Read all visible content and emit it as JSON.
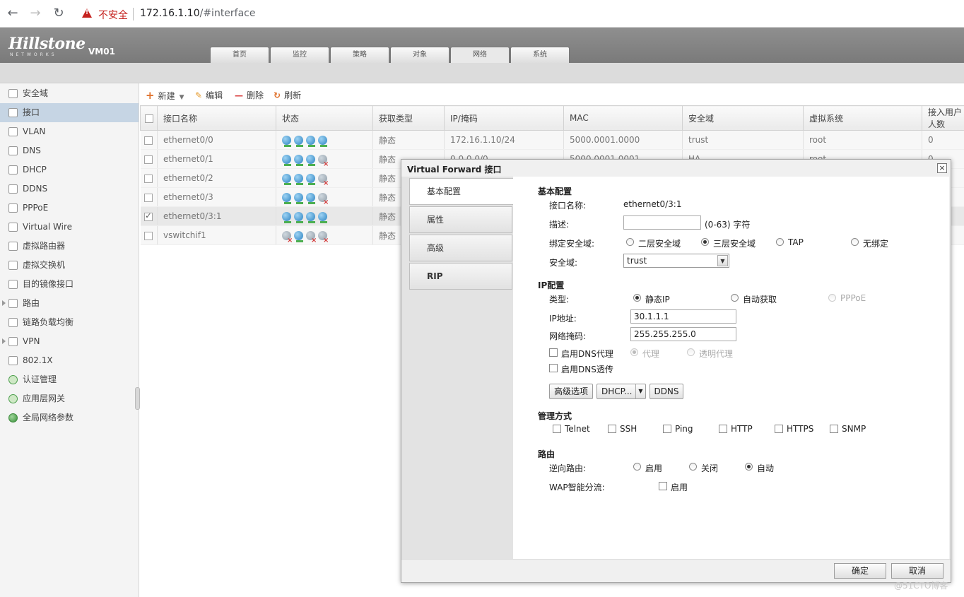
{
  "browser": {
    "back": "←",
    "forward": "→",
    "reload": "↻",
    "security_text": "不安全",
    "url_host": "172.16.1.10",
    "url_path": "/#interface"
  },
  "header": {
    "logo": "Hillstone",
    "logo_sub": "NETWORKS",
    "device": "VM01",
    "tabs": [
      "首页",
      "监控",
      "策略",
      "对象",
      "网络",
      "系统"
    ],
    "active_tab": "网络"
  },
  "sidebar": {
    "items": [
      {
        "label": "安全域"
      },
      {
        "label": "接口",
        "active": true
      },
      {
        "label": "VLAN"
      },
      {
        "label": "DNS"
      },
      {
        "label": "DHCP"
      },
      {
        "label": "DDNS"
      },
      {
        "label": "PPPoE"
      },
      {
        "label": "Virtual Wire"
      },
      {
        "label": "虚拟路由器"
      },
      {
        "label": "虚拟交换机"
      },
      {
        "label": "目的镜像接口"
      },
      {
        "label": "路由",
        "expandable": true
      },
      {
        "label": "链路负载均衡"
      },
      {
        "label": "VPN",
        "expandable": true
      },
      {
        "label": "802.1X"
      },
      {
        "label": "认证管理"
      },
      {
        "label": "应用层网关"
      },
      {
        "label": "全局网络参数"
      }
    ]
  },
  "toolbar": {
    "new": "新建",
    "edit": "编辑",
    "delete": "删除",
    "refresh": "刷新"
  },
  "table": {
    "columns": [
      "接口名称",
      "状态",
      "获取类型",
      "IP/掩码",
      "MAC",
      "安全域",
      "虚拟系统",
      "接入用户人数"
    ],
    "rows": [
      {
        "name": "ethernet0/0",
        "status": [
          "up",
          "up",
          "up",
          "up"
        ],
        "type": "静态",
        "ip": "172.16.1.10/24",
        "mac": "5000.0001.0000",
        "zone": "trust",
        "vsys": "root",
        "users": "0",
        "checked": false
      },
      {
        "name": "ethernet0/1",
        "status": [
          "up",
          "up",
          "up",
          "down"
        ],
        "type": "静态",
        "ip": "0.0.0.0/0",
        "mac": "5000.0001.0001",
        "zone": "HA",
        "vsys": "root",
        "users": "0",
        "checked": false
      },
      {
        "name": "ethernet0/2",
        "status": [
          "up",
          "up",
          "up",
          "down"
        ],
        "type": "静态",
        "ip": "",
        "mac": "",
        "zone": "",
        "vsys": "",
        "users": "",
        "checked": false
      },
      {
        "name": "ethernet0/3",
        "status": [
          "up",
          "up",
          "up",
          "down"
        ],
        "type": "静态",
        "ip": "",
        "mac": "",
        "zone": "",
        "vsys": "",
        "users": "",
        "checked": false
      },
      {
        "name": "ethernet0/3:1",
        "status": [
          "up",
          "up",
          "up",
          "up"
        ],
        "type": "静态",
        "ip": "",
        "mac": "",
        "zone": "",
        "vsys": "",
        "users": "",
        "checked": true
      },
      {
        "name": "vswitchif1",
        "status": [
          "down",
          "up",
          "down",
          "down"
        ],
        "type": "静态",
        "ip": "",
        "mac": "",
        "zone": "",
        "vsys": "",
        "users": "",
        "checked": false
      }
    ]
  },
  "dialog": {
    "title": "Virtual Forward 接口",
    "close": "×",
    "tabs": [
      "基本配置",
      "属性",
      "高级",
      "RIP"
    ],
    "basic": {
      "section": "基本配置",
      "name_label": "接口名称:",
      "name_value": "ethernet0/3:1",
      "desc_label": "描述:",
      "desc_value": "",
      "desc_hint": "(0-63) 字符",
      "bind_label": "绑定安全域:",
      "bind_options": [
        "二层安全域",
        "三层安全域",
        "TAP",
        "无绑定"
      ],
      "bind_selected": "三层安全域",
      "zone_label": "安全域:",
      "zone_value": "trust",
      "zone_arrow": "▼"
    },
    "ip": {
      "section": "IP配置",
      "type_label": "类型:",
      "type_options": [
        "静态IP",
        "自动获取",
        "PPPoE"
      ],
      "type_selected": "静态IP",
      "addr_label": "IP地址:",
      "addr_value": "30.1.1.1",
      "mask_label": "网络掩码:",
      "mask_value": "255.255.255.0",
      "dns_proxy": "启用DNS代理",
      "proxy_opt1": "代理",
      "proxy_opt2": "透明代理",
      "dns_trans": "启用DNS透传",
      "btn_advanced": "高级选项",
      "btn_dhcp": "DHCP...",
      "btn_dhcp_caret": "▼",
      "btn_ddns": "DDNS"
    },
    "mgmt": {
      "section": "管理方式",
      "options": [
        "Telnet",
        "SSH",
        "Ping",
        "HTTP",
        "HTTPS",
        "SNMP"
      ]
    },
    "route": {
      "section": "路由",
      "reverse_label": "逆向路由:",
      "reverse_options": [
        "启用",
        "关闭",
        "自动"
      ],
      "reverse_selected": "自动",
      "wap_label": "WAP智能分流:",
      "wap_option": "启用"
    },
    "ok": "确定",
    "cancel": "取消"
  },
  "watermark": "@51CTO博客",
  "colors": {
    "header_bg": "#858585",
    "sidebar_active": "#c6d5e4",
    "insecure_red": "#c5221f",
    "accent_orange": "#e0712b"
  }
}
